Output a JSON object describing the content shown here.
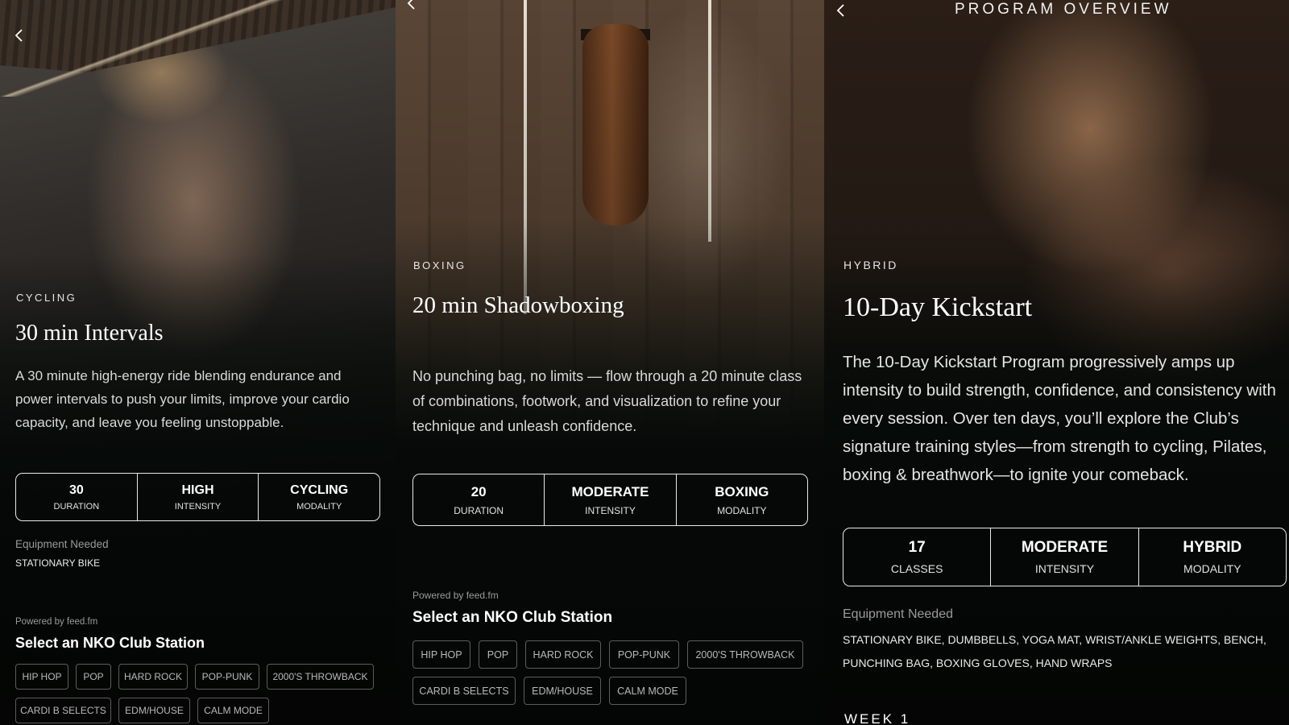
{
  "screens": [
    {
      "category": "CYCLING",
      "title": "30 min Intervals",
      "description": "A 30 minute high-energy ride blending endurance and power intervals to push your limits, improve your cardio capacity, and leave you feeling unstoppable.",
      "stats": [
        {
          "value": "30",
          "label": "DURATION"
        },
        {
          "value": "HIGH",
          "label": "INTENSITY"
        },
        {
          "value": "CYCLING",
          "label": "MODALITY"
        }
      ],
      "equipment_label": "Equipment Needed",
      "equipment_value": "STATIONARY BIKE",
      "powered_by": "Powered by feed.fm",
      "station_title": "Select an NKO Club Station",
      "stations": [
        "HIP HOP",
        "POP",
        "HARD ROCK",
        "POP-PUNK",
        "2000'S THROWBACK",
        "CARDI B SELECTS",
        "EDM/HOUSE",
        "CALM MODE"
      ]
    },
    {
      "category": "BOXING",
      "title": "20 min Shadowboxing",
      "description": "No punching bag, no limits — flow through a 20 minute class of combinations, footwork, and visualization to refine your technique and unleash confidence.",
      "stats": [
        {
          "value": "20",
          "label": "DURATION"
        },
        {
          "value": "MODERATE",
          "label": "INTENSITY"
        },
        {
          "value": "BOXING",
          "label": "MODALITY"
        }
      ],
      "powered_by": "Powered by feed.fm",
      "station_title": "Select an NKO Club Station",
      "stations": [
        "HIP HOP",
        "POP",
        "HARD ROCK",
        "POP-PUNK",
        "2000'S THROWBACK",
        "CARDI B SELECTS",
        "EDM/HOUSE",
        "CALM MODE"
      ]
    },
    {
      "header": "PROGRAM OVERVIEW",
      "category": "HYBRID",
      "title": "10-Day Kickstart",
      "description": "The 10-Day Kickstart Program progressively amps up intensity to build strength, confidence, and consistency with every session. Over ten days, you’ll explore the Club’s signature training styles—from strength to cycling, Pilates, boxing & breathwork—to ignite your comeback.",
      "stats": [
        {
          "value": "17",
          "label": "CLASSES"
        },
        {
          "value": "MODERATE",
          "label": "INTENSITY"
        },
        {
          "value": "HYBRID",
          "label": "MODALITY"
        }
      ],
      "equipment_label": "Equipment Needed",
      "equipment_value": "STATIONARY BIKE, DUMBBELLS, YOGA MAT, WRIST/ANKLE WEIGHTS, BENCH, PUNCHING BAG, BOXING GLOVES, HAND WRAPS",
      "week": "WEEK 1"
    }
  ],
  "icons": {
    "back": "chevron-left-icon"
  }
}
